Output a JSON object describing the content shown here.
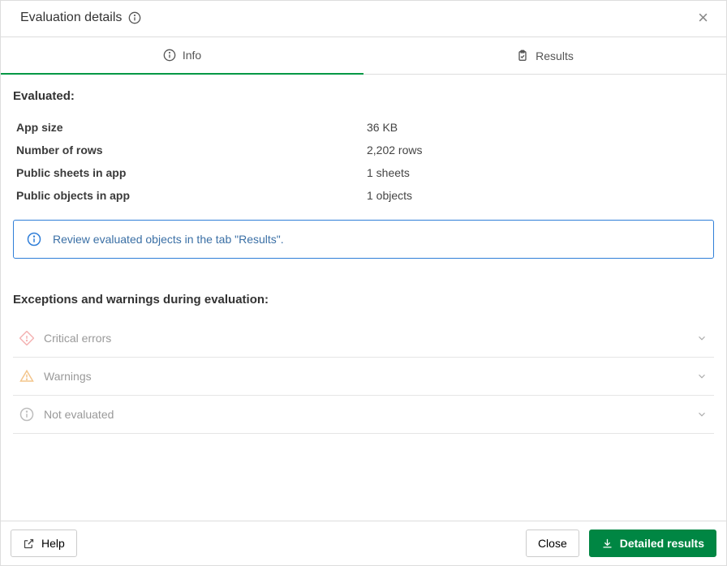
{
  "header": {
    "title": "Evaluation details",
    "close_label": "×"
  },
  "tabs": {
    "info": "Info",
    "results": "Results"
  },
  "evaluated": {
    "title": "Evaluated:",
    "rows": {
      "app_size_k": "App size",
      "app_size_v": "36 KB",
      "num_rows_k": "Number of rows",
      "num_rows_v": "2,202 rows",
      "sheets_k": "Public sheets in app",
      "sheets_v": "1 sheets",
      "objects_k": "Public objects in app",
      "objects_v": "1 objects"
    },
    "review_msg": "Review evaluated objects in the tab \"Results\"."
  },
  "exceptions": {
    "title": "Exceptions and warnings during evaluation:",
    "critical": "Critical errors",
    "warnings": "Warnings",
    "noteval": "Not evaluated"
  },
  "footer": {
    "help": "Help",
    "close": "Close",
    "detailed": "Detailed results"
  }
}
